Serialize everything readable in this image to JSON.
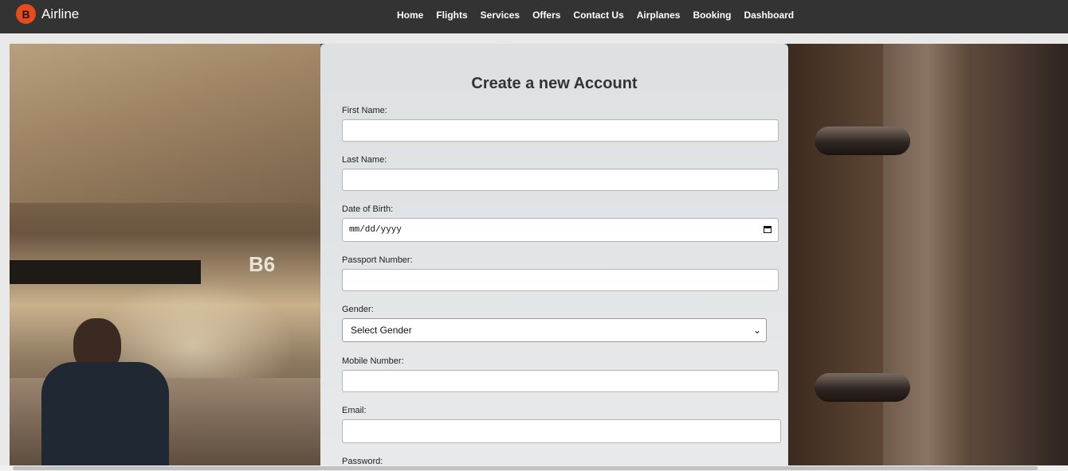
{
  "brand": {
    "logo_letter": "B",
    "name": "Airline"
  },
  "nav": [
    "Home",
    "Flights",
    "Services",
    "Offers",
    "Contact Us",
    "Airplanes",
    "Booking",
    "Dashboard"
  ],
  "hero": {
    "sign_text": "B6"
  },
  "form": {
    "title": "Create a new Account",
    "fields": {
      "first_name": {
        "label": "First Name:",
        "value": ""
      },
      "last_name": {
        "label": "Last Name:",
        "value": ""
      },
      "dob": {
        "label": "Date of Birth:",
        "value": "mm/dd/yyyy"
      },
      "passport": {
        "label": "Passport Number:",
        "value": ""
      },
      "gender": {
        "label": "Gender:",
        "selected": "Select Gender"
      },
      "mobile": {
        "label": "Mobile Number:",
        "value": ""
      },
      "email": {
        "label": "Email:",
        "value": ""
      },
      "password": {
        "label": "Password:"
      }
    }
  },
  "colors": {
    "navbar": "#333333",
    "logo": "#e8491d",
    "card": "#f0f0f0"
  }
}
